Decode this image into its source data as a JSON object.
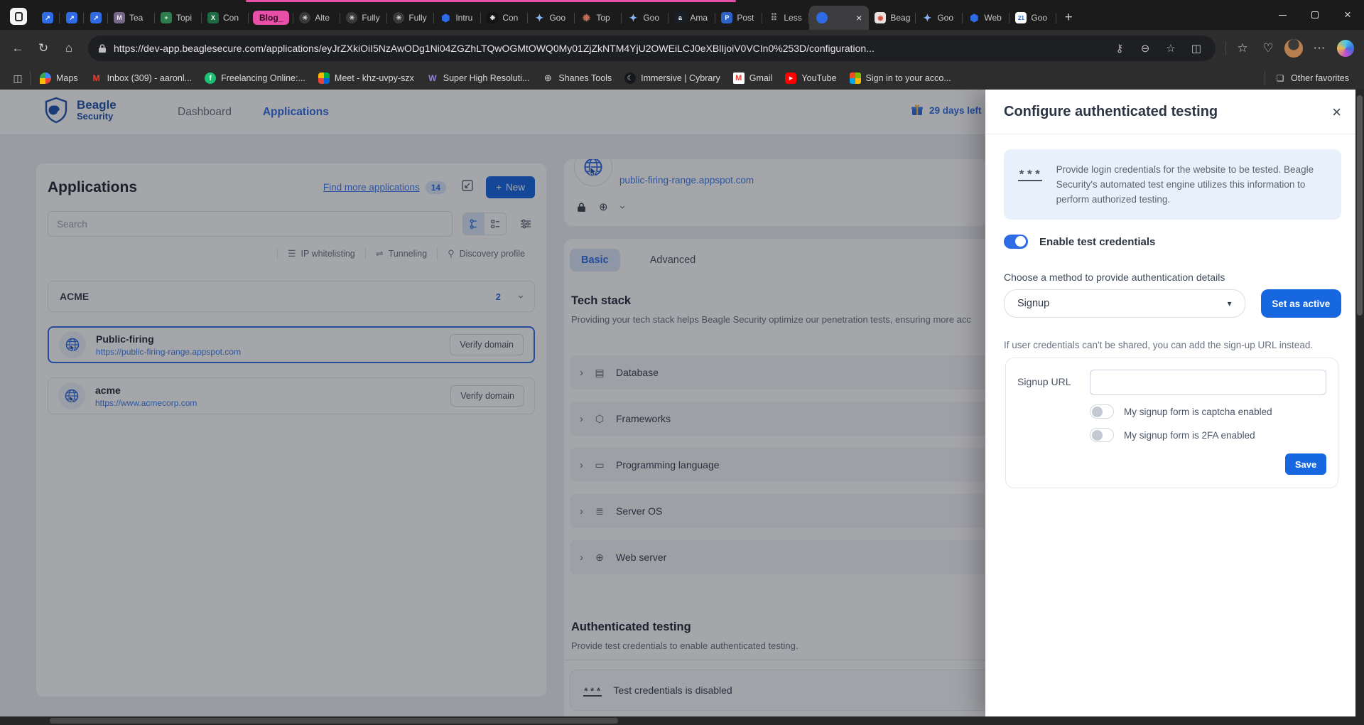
{
  "browser": {
    "new_tab_label": "+",
    "window_icons": {
      "minimize": "minimize",
      "restore": "restore",
      "close": "×"
    },
    "tabs": [
      {
        "cls": "pinned",
        "glyph": "↗",
        "fstyle": "background:#2e6be5;color:#fff"
      },
      {
        "cls": "pinned",
        "glyph": "↗",
        "fstyle": "background:#2e6be5;color:#fff"
      },
      {
        "cls": "pinned",
        "glyph": "↗",
        "fstyle": "background:#2e6be5;color:#fff"
      },
      {
        "cls": "",
        "label": "Tea",
        "glyph": "M",
        "fstyle": "background:#756787;color:#f0ecf5"
      },
      {
        "cls": "",
        "label": "Topi",
        "glyph": "+",
        "fstyle": "background:#2e7d4f;color:#eafbe7"
      },
      {
        "cls": "",
        "label": "Con",
        "glyph": "X",
        "fstyle": "background:#1d6b42;color:#fff"
      },
      {
        "cls": "grouplabel",
        "label": "Blog_"
      },
      {
        "cls": "",
        "label": "Alte",
        "glyph": "✳",
        "fstyle": "background:#3a3a3a;color:#d9d9d9;border-radius:50%"
      },
      {
        "cls": "",
        "label": "Fully",
        "glyph": "✳",
        "fstyle": "background:#3a3a3a;color:#d9d9d9;border-radius:50%"
      },
      {
        "cls": "",
        "label": "Fully",
        "glyph": "✳",
        "fstyle": "background:#3a3a3a;color:#d9d9d9;border-radius:50%"
      },
      {
        "cls": "",
        "label": "Intru",
        "glyph": "⬢",
        "fstyle": "color:#2e6be5;font-size:14px"
      },
      {
        "cls": "",
        "label": "Con",
        "glyph": "❋",
        "fstyle": "background:#141414;color:#e8e8e8"
      },
      {
        "cls": "",
        "label": "Goo",
        "glyph": "✦",
        "fstyle": "color:#8ab4f8;font-size:14px"
      },
      {
        "cls": "",
        "label": "Top",
        "glyph": "✹",
        "fstyle": "color:#c06a55;font-size:14px"
      },
      {
        "cls": "",
        "label": "Goo",
        "glyph": "✦",
        "fstyle": "color:#8ab4f8;font-size:14px"
      },
      {
        "cls": "",
        "label": "Ama",
        "glyph": "a",
        "fstyle": "background:#181f29;color:#fff"
      },
      {
        "cls": "",
        "label": "Post",
        "glyph": "P",
        "fstyle": "background:#2d62c6;color:#fff"
      },
      {
        "cls": "",
        "label": "Less",
        "glyph": "⠿",
        "fstyle": "color:#9a9a9a;font-size:13px"
      },
      {
        "cls": "active",
        "glyph": "",
        "fstyle": "background:#2e6be5;border-radius:50%",
        "close": "×"
      },
      {
        "cls": "",
        "label": "Beag",
        "glyph": "◉",
        "fstyle": "background:#e9e3e0;color:#d04a3e"
      },
      {
        "cls": "",
        "label": "Goo",
        "glyph": "✦",
        "fstyle": "color:#8ab4f8;font-size:14px"
      },
      {
        "cls": "",
        "label": "Web",
        "glyph": "⬢",
        "fstyle": "color:#2e6be5;font-size:14px"
      },
      {
        "cls": "",
        "label": "Goo",
        "glyph": "21",
        "fstyle": "background:#fff;color:#1a73e8;font-size:8px"
      }
    ],
    "toolbar": {
      "url": "https://dev-app.beaglesecure.com/applications/eyJrZXkiOiI5NzAwODg1Ni04ZGZhLTQwOGMtOWQ0My01ZjZkNTM4YjU2OWEiLCJ0eXBlIjoiV0VCIn0%253D/configuration...",
      "icons": {
        "back": "←",
        "refresh": "↻",
        "home": "⌂",
        "key": "⚷",
        "zoom_out": "⊖",
        "favorite_star": "☆",
        "split_screen": "◫",
        "favorites_bar": "☆",
        "essentials": "♡",
        "more": "⋯"
      }
    },
    "bookmarks": {
      "sidebar_icon": "◫",
      "items": [
        {
          "label": "Maps",
          "glyph": "",
          "fstyle": "background:conic-gradient(#4285f4 0 25%,#ea4335 0 50%,#fbbc04 0 75%,#34a853 0);border-radius:50% 50% 50% 0"
        },
        {
          "label": "Inbox (309) - aaronl...",
          "glyph": "M",
          "fstyle": "color:#ea4335;font-weight:700;font-size:12px"
        },
        {
          "label": "Freelancing Online:...",
          "glyph": "f",
          "fstyle": "background:#1dbf73;color:#fff;border-radius:50%;font-weight:700"
        },
        {
          "label": "Meet - khz-uvpy-szx",
          "glyph": "",
          "fstyle": "background:conic-gradient(#00ac47 0 25%,#0066da 0 50%,#ea4335 0 75%,#ffba00 0);border-radius:4px"
        },
        {
          "label": "Super High Resoluti...",
          "glyph": "W",
          "fstyle": "color:#8f86e0;font-weight:700;font-size:12px"
        },
        {
          "label": "Shanes Tools",
          "glyph": "⊕",
          "fstyle": "color:#cfcfcf;font-size:13px"
        },
        {
          "label": "Immersive | Cybrary",
          "glyph": "☾",
          "fstyle": "background:#15171c;color:#e8e8e8;border-radius:50%"
        },
        {
          "label": "Gmail",
          "glyph": "M",
          "fstyle": "background:#fff;color:#ea4335;font-weight:700;border-radius:2px;font-size:11px"
        },
        {
          "label": "YouTube",
          "glyph": "▶",
          "fstyle": "background:#ff0000;color:#fff;font-size:7px;border-radius:4px"
        },
        {
          "label": "Sign in to your acco...",
          "glyph": "",
          "fstyle": "background:conic-gradient(#7fba00 0 25%,#ffb900 0 50%,#00a4ef 0 75%,#f25022 0)"
        }
      ],
      "other_favorites": "Other favorites",
      "folder_icon": "❏"
    }
  },
  "app": {
    "header": {
      "brand_line1": "Beagle",
      "brand_line2": "Security",
      "nav": [
        {
          "label": "Dashboard",
          "cls": ""
        },
        {
          "label": "Applications",
          "cls": "active"
        }
      ],
      "trial": "29 days left"
    },
    "left_panel": {
      "title": "Applications",
      "find_link": "Find more applications",
      "find_count": "14",
      "new_plus": "+",
      "new_label": "New",
      "search_placeholder": "Search",
      "filters": [
        {
          "label": "IP whitelisting",
          "glyph": "☰"
        },
        {
          "label": "Tunneling",
          "glyph": "⇌"
        },
        {
          "label": "Discovery profile",
          "glyph": "⚲"
        }
      ],
      "group": {
        "name": "ACME",
        "count": "2"
      },
      "apps": [
        {
          "cls": "selected",
          "name": "Public-firing",
          "url": "https://public-firing-range.appspot.com",
          "action": "Verify domain"
        },
        {
          "cls": "",
          "name": "acme",
          "url": "https://www.acmecorp.com",
          "action": "Verify domain"
        }
      ]
    },
    "detail": {
      "domain": "public-firing-range.appspot.com",
      "globe_glyph": "⊕",
      "chevron_glyph": "›",
      "tabs": [
        {
          "label": "Basic",
          "cls": "active"
        },
        {
          "label": "Advanced",
          "cls": ""
        }
      ],
      "tech": {
        "title": "Tech stack",
        "subtitle": "Providing your tech stack helps Beagle Security optimize our penetration tests, ensuring more acc"
      },
      "accordions": [
        {
          "label": "Database",
          "glyph": "▤"
        },
        {
          "label": "Frameworks",
          "glyph": "⬡"
        },
        {
          "label": "Programming language",
          "glyph": "▭"
        },
        {
          "label": "Server OS",
          "glyph": "≣"
        },
        {
          "label": "Web server",
          "glyph": "⊕"
        }
      ],
      "auth": {
        "title": "Authenticated testing",
        "subtitle": "Provide test credentials to enable authenticated testing.",
        "status_icon": "***",
        "status": "Test credentials is disabled"
      }
    },
    "drawer": {
      "title": "Configure authenticated testing",
      "close": "×",
      "info_icon": "***",
      "info": "Provide login credentials for the website to be tested. Beagle Security's automated test engine utilizes this information to perform authorized testing.",
      "enable_label": "Enable test credentials",
      "method_label": "Choose a method to provide authentication details",
      "method_value": "Signup",
      "caret": "▾",
      "set_active": "Set as active",
      "hint": "If user credentials can't be shared, you can add the sign-up URL instead.",
      "url_label": "Signup URL",
      "url_value": "",
      "captcha_label": "My signup form is captcha enabled",
      "twofa_label": "My signup form is 2FA enabled",
      "save": "Save"
    }
  },
  "colors": {
    "primary_button": "#1667e0",
    "link_blue": "#3d7ef0",
    "brand_blue": "#1d55ae",
    "tab_group_pink": "#e84fa8",
    "info_box_bg": "#e8f1fb"
  }
}
